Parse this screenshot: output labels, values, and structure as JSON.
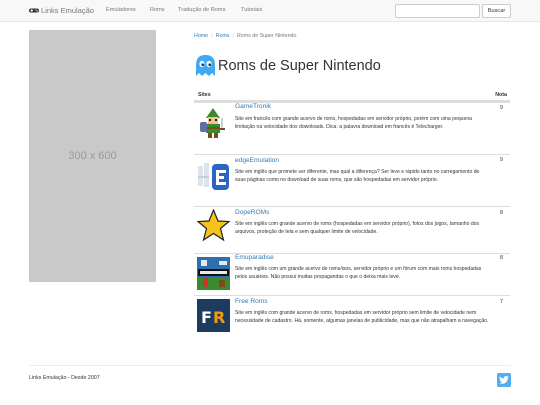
{
  "navbar": {
    "brand": "Links Emulação",
    "links": [
      "Emuladores",
      "Roms",
      "Tradução de Roms",
      "Tutoriais"
    ],
    "search_placeholder": "",
    "search_button": "Buscar"
  },
  "ad": {
    "label": "300 x 600"
  },
  "breadcrumb": {
    "home": "Home",
    "roms": "Roms",
    "current": "Roms de Super Nintendo"
  },
  "page_title": "Roms de Super Nintendo",
  "table": {
    "headers": {
      "sites": "Sites",
      "nota": "Nota"
    },
    "rows": [
      {
        "name": "GameTronik",
        "desc": "Site em francês com grande acervo de roms, hospedadas em servidor próprio, porém com uma pequena limitação na velocidade dos downloads. Dica: a palavra download em francês é Telecharger.",
        "nota": "9"
      },
      {
        "name": "edgeEmulation",
        "desc": "Site em inglês que promete ser diferente, mas qual a diferença? Ser leve e rápido tanto no carregamento de suas páginas como no download de suas roms, que são hospedadas em servidor próprio.",
        "nota": "9"
      },
      {
        "name": "DopeROMs",
        "desc": "Site em inglês com grande acervo de roms (hospedadas em servidor próprio), fotos dos jogos, tamanho dos arquivos, proteção de tela e sem qualquer limite de velocidade.",
        "nota": "8"
      },
      {
        "name": "Emuparadise",
        "desc": "Site em inglês com um grande acervo de roms/isos, servidor próprio e um fórum com mais roms hospedadas pelos usuários. Não possui muitas propagandas o que o deixa mais leve.",
        "nota": "8"
      },
      {
        "name": "Free Roms",
        "desc": "Site em inglês com grande acervo de roms, hospedadas em servidor próprio sem limite de velocidade nem necessidade de cadastro. Há, somente, algumas janelas de publicidade, mas que não atrapalham a navegação.",
        "nota": "7"
      }
    ]
  },
  "footer": {
    "text": "Links Emulação - Desde 2007"
  },
  "colors": {
    "link": "#337ab7",
    "navbar_bg": "#f8f8f8",
    "ghost": "#3fa9f5",
    "twitter": "#55acee"
  },
  "icons": {
    "brand": "gamepad-icon",
    "title": "pacman-ghost-icon",
    "social": "twitter-icon"
  }
}
